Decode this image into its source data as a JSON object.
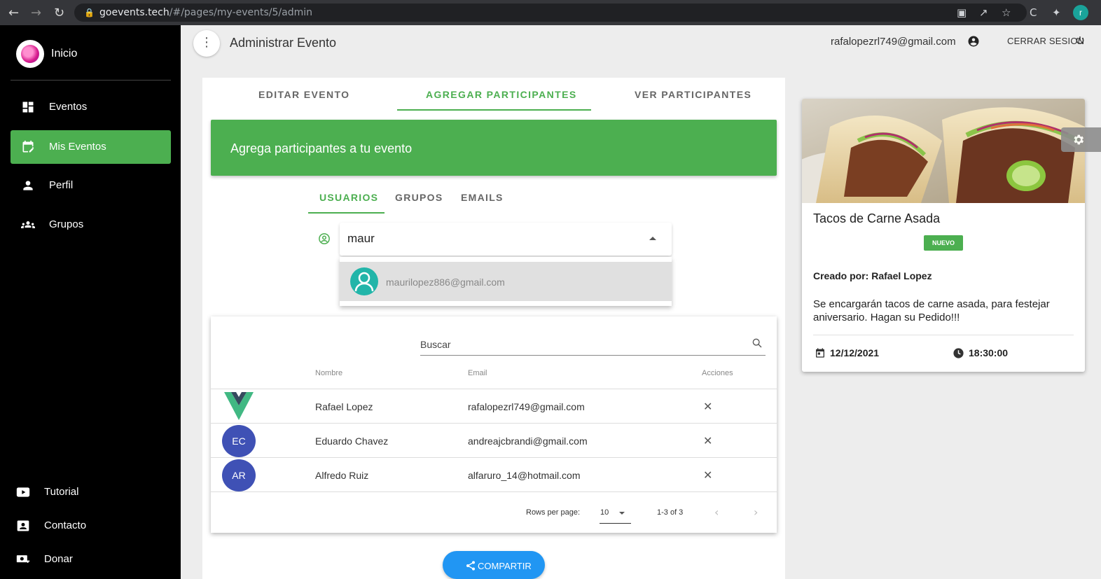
{
  "browser": {
    "url_host": "goevents.tech",
    "url_path": "/#/pages/my-events/5/admin",
    "profile_initial": "r"
  },
  "sidebar": {
    "brand": "Inicio",
    "items": [
      {
        "label": "Eventos",
        "icon": "dashboard-icon"
      },
      {
        "label": "Mis Eventos",
        "icon": "calendar-edit-icon",
        "active": true
      },
      {
        "label": "Perfil",
        "icon": "person-icon"
      },
      {
        "label": "Grupos",
        "icon": "group-icon"
      }
    ],
    "bottom": [
      {
        "label": "Tutorial",
        "icon": "youtube-icon"
      },
      {
        "label": "Contacto",
        "icon": "contact-card-icon"
      },
      {
        "label": "Donar",
        "icon": "donate-icon"
      }
    ]
  },
  "header": {
    "title": "Administrar Evento",
    "email": "rafalopezrl749@gmail.com",
    "logout": "CERRAR SESION"
  },
  "tabs": [
    "EDITAR EVENTO",
    "AGREGAR PARTICIPANTES",
    "VER PARTICIPANTES"
  ],
  "banner": "Agrega participantes a tu evento",
  "subtabs": [
    "USUARIOS",
    "GRUPOS",
    "EMAILS"
  ],
  "combo": {
    "value": "maur",
    "option": "maurilopez886@gmail.com"
  },
  "table": {
    "search_label": "Buscar",
    "headers": [
      "Nombre",
      "Email",
      "Acciones"
    ],
    "rows": [
      {
        "avatar": "",
        "name": "Rafael Lopez",
        "email": "rafalopezrl749@gmail.com"
      },
      {
        "avatar": "EC",
        "name": "Eduardo Chavez",
        "email": "andreajcbrandi@gmail.com"
      },
      {
        "avatar": "AR",
        "name": "Alfredo Ruiz",
        "email": "alfaruro_14@hotmail.com"
      }
    ],
    "rows_per_page_label": "Rows per page:",
    "rows_per_page": "10",
    "range": "1-3 of 3"
  },
  "share_label": "COMPARTIR",
  "event": {
    "title": "Tacos de Carne Asada",
    "badge": "NUEVO",
    "creator": "Creado por: Rafael Lopez",
    "description": "Se encargarán tacos de carne asada, para festejar aniversario. Hagan su Pedido!!!",
    "date": "12/12/2021",
    "time": "18:30:00"
  },
  "colors": {
    "accent": "#4caf50",
    "sidebar_bg": "#000000",
    "share": "#2196f3",
    "avatar": "#3f51b5"
  }
}
